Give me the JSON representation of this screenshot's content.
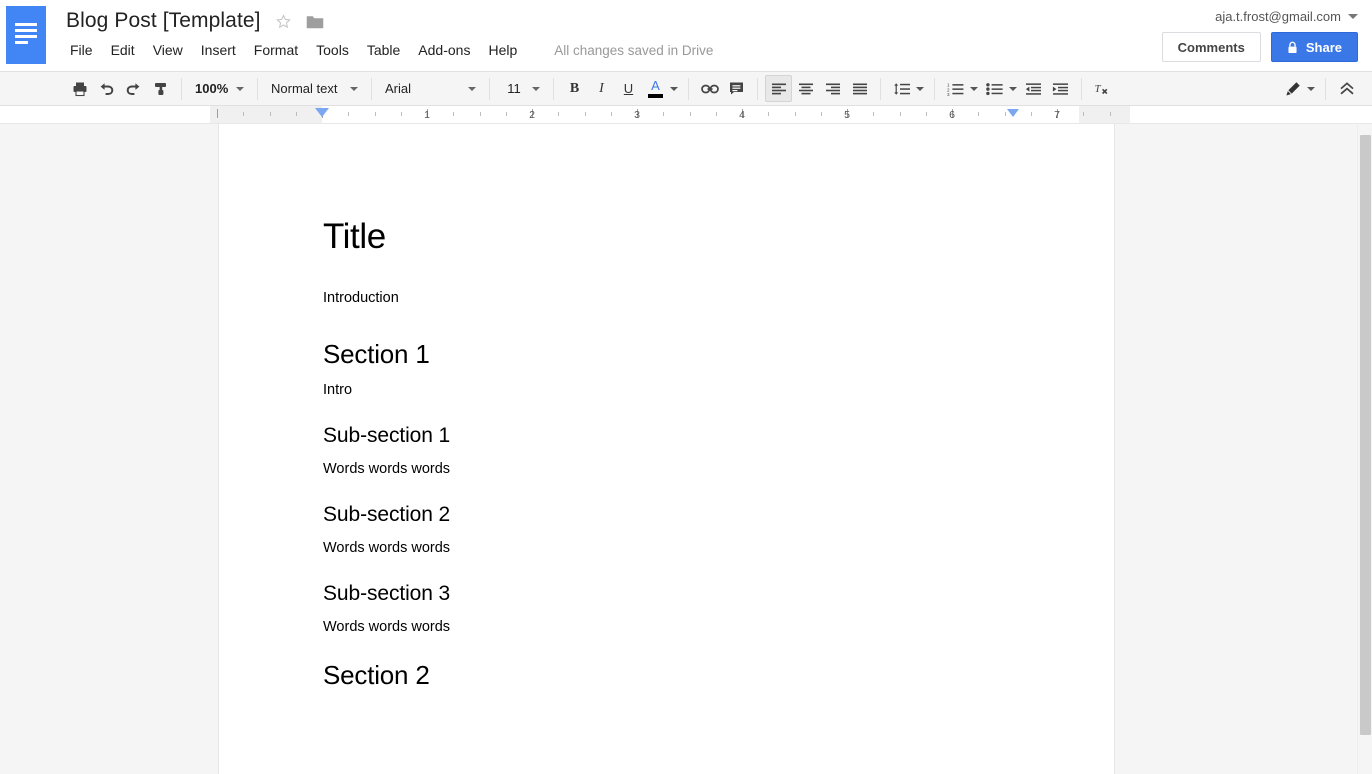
{
  "app": {
    "logo_icon": "docs-hamburger-icon"
  },
  "header": {
    "doc_title": "Blog Post [Template]",
    "star_icon": "star-icon",
    "folder_icon": "folder-icon",
    "menus": [
      "File",
      "Edit",
      "View",
      "Insert",
      "Format",
      "Tools",
      "Table",
      "Add-ons",
      "Help"
    ],
    "save_status": "All changes saved in Drive",
    "account_email": "aja.t.frost@gmail.com",
    "account_caret_icon": "chevron-down-icon",
    "comments_label": "Comments",
    "share_label": "Share",
    "share_lock_icon": "lock-icon",
    "share_color": "#3b78e7"
  },
  "toolbar": {
    "print_icon": "print-icon",
    "undo_icon": "undo-icon",
    "redo_icon": "redo-icon",
    "paint_format_icon": "paint-format-icon",
    "zoom_value": "100%",
    "paragraph_style": "Normal text",
    "font_family": "Arial",
    "font_size": "11",
    "bold_label": "B",
    "italic_label": "I",
    "underline_label": "U",
    "text_color_label": "A",
    "text_color_swatch": "#000000",
    "text_color_letter_color": "#3b78e7",
    "link_icon": "link-icon",
    "comment_icon": "add-comment-icon",
    "align_left_icon": "align-left-icon",
    "align_center_icon": "align-center-icon",
    "align_right_icon": "align-right-icon",
    "align_justify_icon": "align-justify-icon",
    "line_spacing_icon": "line-spacing-icon",
    "numbered_list_icon": "numbered-list-icon",
    "bulleted_list_icon": "bulleted-list-icon",
    "indent_decrease_icon": "indent-decrease-icon",
    "indent_increase_icon": "indent-increase-icon",
    "clear_formatting_icon": "clear-formatting-icon",
    "edit_mode_icon": "pencil-icon",
    "collapse_toolbar_icon": "chevron-double-up-icon"
  },
  "ruler": {
    "numbers": [
      "1",
      "2",
      "3",
      "4",
      "5",
      "6",
      "7"
    ],
    "left_indent_marker": "left-indent-marker",
    "right_indent_marker": "right-indent-marker"
  },
  "document": {
    "blocks": [
      {
        "type": "h1",
        "text": "Title"
      },
      {
        "type": "p",
        "text": "Introduction"
      },
      {
        "type": "h2",
        "text": "Section 1"
      },
      {
        "type": "p",
        "text": "Intro"
      },
      {
        "type": "h3",
        "text": "Sub-section 1"
      },
      {
        "type": "p",
        "text": "Words words words"
      },
      {
        "type": "h3",
        "text": "Sub-section 2"
      },
      {
        "type": "p",
        "text": "Words words words"
      },
      {
        "type": "h3",
        "text": "Sub-section 3"
      },
      {
        "type": "p",
        "text": "Words words words"
      },
      {
        "type": "h2",
        "text": "Section 2"
      }
    ]
  }
}
